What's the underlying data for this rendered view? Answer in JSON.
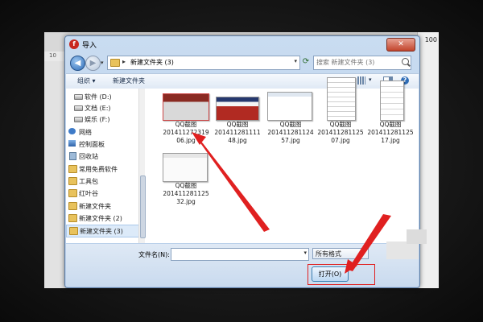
{
  "background_app": {
    "zoom_label": "100",
    "ruler_ticks": [
      "10",
      "10"
    ]
  },
  "dialog": {
    "title": "导入",
    "close_glyph": "✕",
    "address": {
      "separator": "▸",
      "path": "新建文件夹 (3)",
      "dropdown_glyph": "▾"
    },
    "search": {
      "placeholder": "搜索 新建文件夹 (3)"
    },
    "toolbar": {
      "organize_label": "组织 ▾",
      "new_folder_label": "新建文件夹",
      "help_glyph": "?"
    },
    "nav_items": [
      {
        "label": "软件 (D:)",
        "icon": "drive-icon"
      },
      {
        "label": "文档 (E:)",
        "icon": "drive-icon"
      },
      {
        "label": "娱乐 (F:)",
        "icon": "drive-icon"
      },
      {
        "label": "网络",
        "icon": "network-icon"
      },
      {
        "label": "控制面板",
        "icon": "control-panel-icon"
      },
      {
        "label": "回收站",
        "icon": "recycle-bin-icon"
      },
      {
        "label": "常用免费软件",
        "icon": "folder-icon"
      },
      {
        "label": "工具包",
        "icon": "folder-icon"
      },
      {
        "label": "红叶谷",
        "icon": "folder-icon"
      },
      {
        "label": "新建文件夹",
        "icon": "folder-icon"
      },
      {
        "label": "新建文件夹 (2)",
        "icon": "folder-icon"
      },
      {
        "label": "新建文件夹 (3)",
        "icon": "folder-icon",
        "selected": true
      }
    ],
    "files": [
      {
        "line1": "QQ截图",
        "line2": "201411272319",
        "line3": "06.jpg"
      },
      {
        "line1": "QQ截图",
        "line2": "201411281111",
        "line3": "48.jpg"
      },
      {
        "line1": "QQ截图",
        "line2": "201411281124",
        "line3": "57.jpg"
      },
      {
        "line1": "QQ截图",
        "line2": "201411281125",
        "line3": "07.jpg"
      },
      {
        "line1": "QQ截图",
        "line2": "201411281125",
        "line3": "17.jpg"
      },
      {
        "line1": "QQ截图",
        "line2": "201411281125",
        "line3": "32.jpg"
      }
    ],
    "filename_label": "文件名(N):",
    "filename_value": "",
    "file_type": "所有格式",
    "open_button": "打开(O)"
  },
  "colors": {
    "annotation_red": "#e02020",
    "selection_blue": "#dceaf9",
    "dialog_frame": "#b7cde8"
  }
}
